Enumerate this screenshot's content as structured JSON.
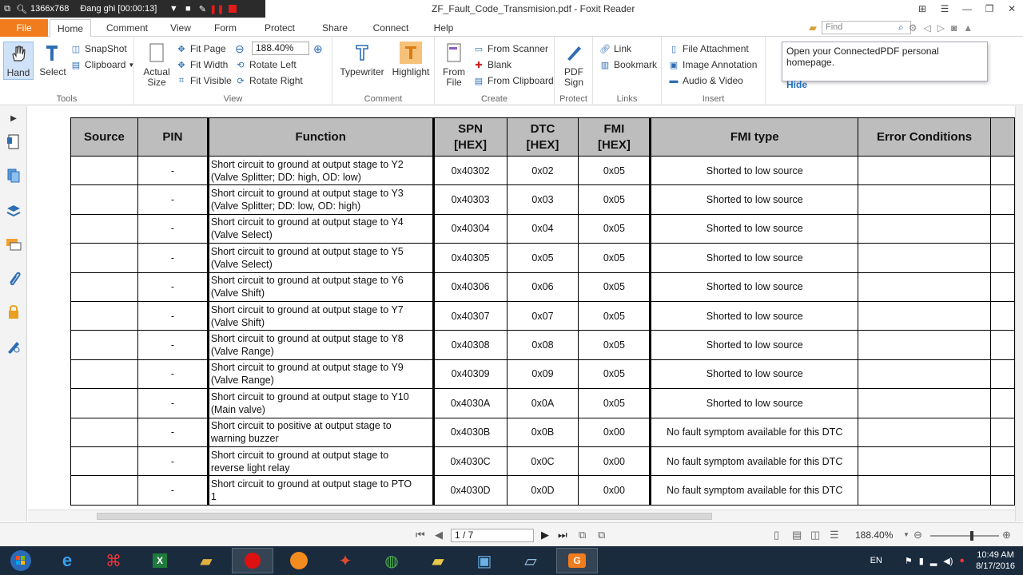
{
  "recorder": {
    "size": "1366x768",
    "status": "Đang ghi [00:00:13]"
  },
  "window": {
    "title": "ZF_Fault_Code_Transmision.pdf - Foxit Reader"
  },
  "tabs": [
    "File",
    "Home",
    "Comment",
    "View",
    "Form",
    "Protect",
    "Share",
    "Connect",
    "Help"
  ],
  "find": {
    "placeholder": "Find"
  },
  "ribbon": {
    "tools": {
      "label": "Tools",
      "hand": "Hand",
      "select": "Select",
      "snapshot": "SnapShot",
      "clipboard": "Clipboard"
    },
    "view": {
      "label": "View",
      "actual_size_1": "Actual",
      "actual_size_2": "Size",
      "fit_page": "Fit Page",
      "fit_width": "Fit Width",
      "fit_visible": "Fit Visible",
      "rotate_left": "Rotate Left",
      "rotate_right": "Rotate Right",
      "zoom": "188.40%"
    },
    "comment": {
      "label": "Comment",
      "typewriter": "Typewriter",
      "highlight": "Highlight"
    },
    "create": {
      "label": "Create",
      "from_file_1": "From",
      "from_file_2": "File",
      "from_scanner": "From Scanner",
      "blank": "Blank",
      "from_clipboard": "From Clipboard"
    },
    "protect": {
      "label": "Protect",
      "pdf_sign_1": "PDF",
      "pdf_sign_2": "Sign"
    },
    "links": {
      "label": "Links",
      "link": "Link",
      "bookmark": "Bookmark"
    },
    "insert": {
      "label": "Insert",
      "file_attachment": "File Attachment",
      "image_annotation": "Image Annotation",
      "audio_video": "Audio & Video"
    }
  },
  "popup": {
    "text": "Open your ConnectedPDF personal homepage.",
    "hide": "Hide"
  },
  "table": {
    "headers": {
      "source": "Source",
      "pin": "PIN",
      "function": "Function",
      "spn_1": "SPN",
      "spn_2": "[HEX]",
      "dtc_1": "DTC",
      "dtc_2": "[HEX]",
      "fmi_1": "FMI",
      "fmi_2": "[HEX]",
      "fmi_type": "FMI type",
      "error": "Error Conditions"
    },
    "rows": [
      {
        "source": "",
        "pin": "-",
        "func_1": "Short circuit to ground at output stage to Y2",
        "func_2": "(Valve Splitter;  DD: high, OD: low)",
        "spn": "0x40302",
        "dtc": "0x02",
        "fmi": "0x05",
        "fmi_type": "Shorted to low source",
        "error": ""
      },
      {
        "source": "",
        "pin": "-",
        "func_1": "Short circuit to ground at output stage to Y3",
        "func_2": "(Valve Splitter;  DD: low, OD: high)",
        "spn": "0x40303",
        "dtc": "0x03",
        "fmi": "0x05",
        "fmi_type": "Shorted to low source",
        "error": ""
      },
      {
        "source": "",
        "pin": "-",
        "func_1": "Short circuit to ground at output stage to Y4",
        "func_2": "(Valve Select)",
        "spn": "0x40304",
        "dtc": "0x04",
        "fmi": "0x05",
        "fmi_type": "Shorted to low source",
        "error": ""
      },
      {
        "source": "",
        "pin": "-",
        "func_1": "Short circuit to ground at output stage to Y5",
        "func_2": "(Valve Select)",
        "spn": "0x40305",
        "dtc": "0x05",
        "fmi": "0x05",
        "fmi_type": "Shorted to low source",
        "error": ""
      },
      {
        "source": "",
        "pin": "-",
        "func_1": "Short circuit to ground at output stage to Y6",
        "func_2": "(Valve Shift)",
        "spn": "0x40306",
        "dtc": "0x06",
        "fmi": "0x05",
        "fmi_type": "Shorted to low source",
        "error": ""
      },
      {
        "source": "",
        "pin": "-",
        "func_1": "Short circuit to ground at output stage to Y7",
        "func_2": "(Valve Shift)",
        "spn": "0x40307",
        "dtc": "0x07",
        "fmi": "0x05",
        "fmi_type": "Shorted to low source",
        "error": ""
      },
      {
        "source": "",
        "pin": "-",
        "func_1": "Short circuit to ground at output stage to Y8",
        "func_2": "(Valve Range)",
        "spn": "0x40308",
        "dtc": "0x08",
        "fmi": "0x05",
        "fmi_type": "Shorted to low source",
        "error": ""
      },
      {
        "source": "",
        "pin": "-",
        "func_1": "Short circuit to ground at output stage to Y9",
        "func_2": "(Valve Range)",
        "spn": "0x40309",
        "dtc": "0x09",
        "fmi": "0x05",
        "fmi_type": "Shorted to low source",
        "error": ""
      },
      {
        "source": "",
        "pin": "-",
        "func_1": "Short circuit to ground at output stage to Y10",
        "func_2": "(Main valve)",
        "spn": "0x4030A",
        "dtc": "0x0A",
        "fmi": "0x05",
        "fmi_type": "Shorted to low source",
        "error": ""
      },
      {
        "source": "",
        "pin": "-",
        "func_1": "Short circuit to positive at output stage to",
        "func_2": "warning buzzer",
        "spn": "0x4030B",
        "dtc": "0x0B",
        "fmi": "0x00",
        "fmi_type": "No fault symptom available for this DTC",
        "error": ""
      },
      {
        "source": "",
        "pin": "-",
        "func_1": "Short circuit to ground at output stage to",
        "func_2": "reverse light relay",
        "spn": "0x4030C",
        "dtc": "0x0C",
        "fmi": "0x00",
        "fmi_type": "No fault symptom available for this DTC",
        "error": ""
      },
      {
        "source": "",
        "pin": "-",
        "func_1": "Short circuit to ground at output stage to PTO",
        "func_2": "1",
        "spn": "0x4030D",
        "dtc": "0x0D",
        "fmi": "0x00",
        "fmi_type": "No fault symptom available for this DTC",
        "error": ""
      }
    ]
  },
  "status": {
    "page": "1 / 7",
    "zoom": "188.40%"
  },
  "taskbar": {
    "lang": "EN",
    "time": "10:49 AM",
    "date": "8/17/2016"
  },
  "colors": {
    "file_tab": "#f07c1e",
    "header_gray": "#bdbdbd",
    "taskbar": "#1a2b3e",
    "accent_blue": "#2f6db5"
  }
}
